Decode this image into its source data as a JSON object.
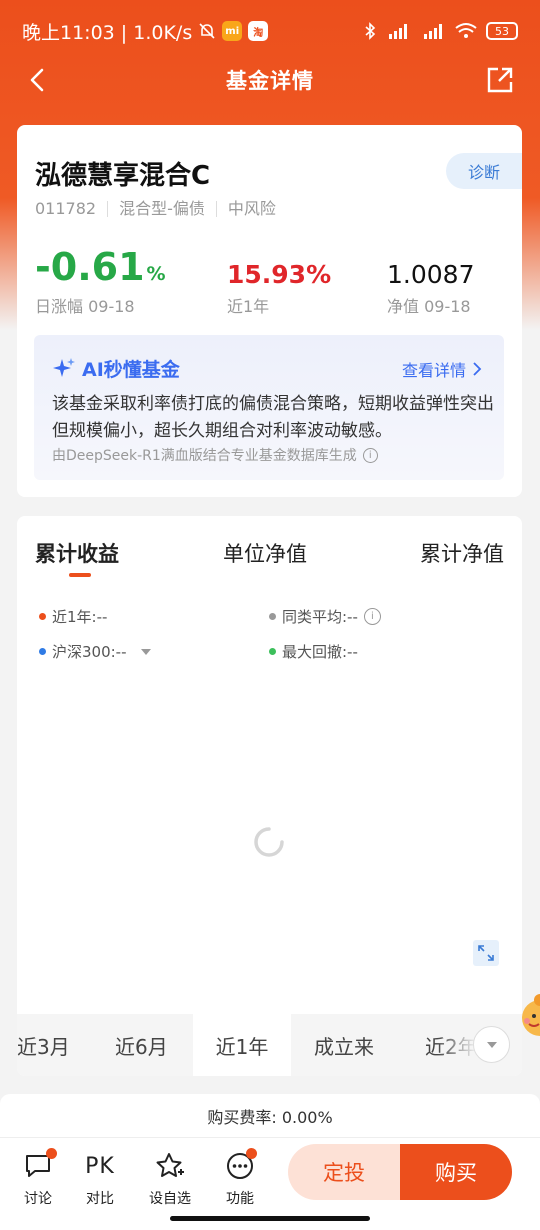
{
  "status_bar": {
    "time_and_speed": "晚上11:03 | 1.0K/s",
    "app_badge_1": "mi",
    "app_badge_2": "淘",
    "battery": "53"
  },
  "nav": {
    "title": "基金详情"
  },
  "fund": {
    "name": "泓德慧享混合C",
    "diagnose_label": "诊断",
    "code": "011782",
    "type": "混合型-偏债",
    "risk": "中风险",
    "daily_change_value": "-0.61",
    "daily_change_unit": "%",
    "daily_change_label": "日涨幅 09-18",
    "one_year_value": "15.93%",
    "one_year_label": "近1年",
    "nav_value": "1.0087",
    "nav_label": "净值 09-18"
  },
  "ai": {
    "title": "AI秒懂基金",
    "more_label": "查看详情",
    "text": "该基金采取利率债打底的偏债混合策略，短期收益弹性突出但规模偏小，超长久期组合对利率波动敏感。",
    "footer": "由DeepSeek-R1满血版结合专业基金数据库生成"
  },
  "chart": {
    "tabs": [
      "累计收益",
      "单位净值",
      "累计净值"
    ],
    "legend": {
      "one_year": "近1年:--",
      "peer_avg": "同类平均:--",
      "hs300": "沪深300:--",
      "max_drawdown": "最大回撤:--"
    },
    "ranges": [
      "近3月",
      "近6月",
      "近1年",
      "成立来",
      "近2年"
    ],
    "colors": {
      "one_year": "#ec4f1c",
      "peer_avg": "#999999",
      "hs300": "#2f7be5",
      "max_drawdown": "#3cbf5b"
    }
  },
  "fee": {
    "text": "购买费率: 0.00%"
  },
  "bottom_bar": {
    "discuss": "讨论",
    "compare_icon_text": "PK",
    "compare": "对比",
    "watchlist": "设自选",
    "features": "功能",
    "auto_invest": "定投",
    "buy": "购买"
  },
  "theme": {
    "brand": "#ec4f1c",
    "up": "#e0262a",
    "down": "#27a847",
    "ai_blue": "#3b6cf0"
  }
}
